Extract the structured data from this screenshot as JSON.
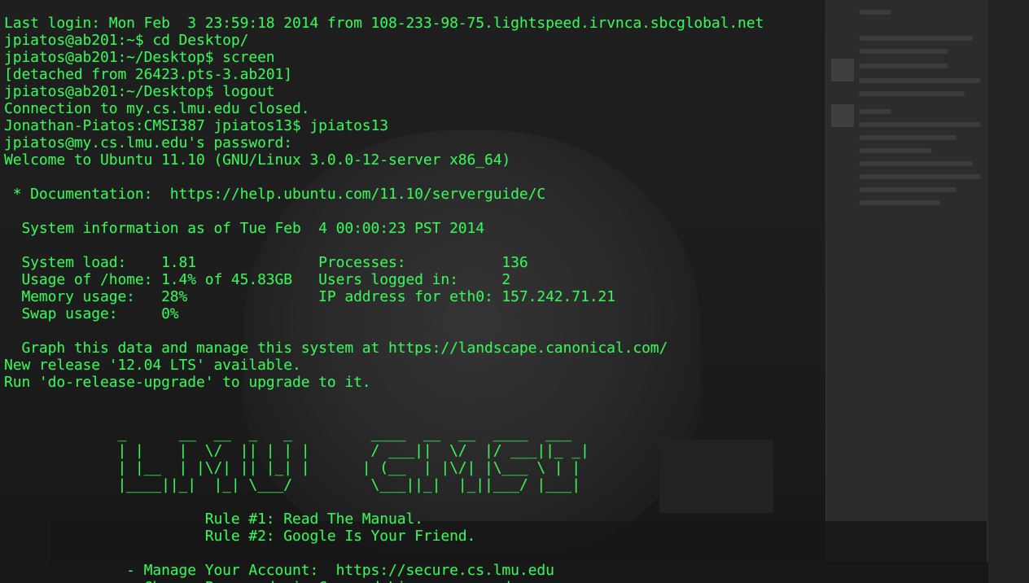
{
  "terminal": {
    "colors": {
      "text": "#3cf05a",
      "background_tint": "rgba(0,0,0,0.25)"
    },
    "lines": [
      "Last login: Mon Feb  3 23:59:18 2014 from 108-233-98-75.lightspeed.irvnca.sbcglobal.net",
      "jpiatos@ab201:~$ cd Desktop/",
      "jpiatos@ab201:~/Desktop$ screen",
      "[detached from 26423.pts-3.ab201]",
      "jpiatos@ab201:~/Desktop$ logout",
      "Connection to my.cs.lmu.edu closed.",
      "Jonathan-Piatos:CMSI387 jpiatos13$ jpiatos13",
      "jpiatos@my.cs.lmu.edu's password:",
      "Welcome to Ubuntu 11.10 (GNU/Linux 3.0.0-12-server x86_64)",
      "",
      " * Documentation:  https://help.ubuntu.com/11.10/serverguide/C",
      "",
      "  System information as of Tue Feb  4 00:00:23 PST 2014",
      "",
      "  System load:    1.81              Processes:           136",
      "  Usage of /home: 1.4% of 45.83GB   Users logged in:     2",
      "  Memory usage:   28%               IP address for eth0: 157.242.71.21",
      "  Swap usage:     0%",
      "",
      "  Graph this data and manage this system at https://landscape.canonical.com/",
      "New release '12.04 LTS' available.",
      "Run 'do-release-upgrade' to upgrade to it.",
      "",
      "",
      "             _      __  __  _   _         ____  __  __  ____  ___ ",
      "             | |    |  \\/  || | | |       / ___||  \\/  |/ ___||_ _|",
      "             | |__  | |\\/| || |_| |      | (__  | |\\/| |\\___ \\ | | ",
      "             |____||_|  |_| \\___/         \\___||_|  |_||___/ |___|",
      "",
      "                       Rule #1: Read The Manual.",
      "                       Rule #2: Google Is Your Friend.",
      "",
      "              - Manage Your Account:  https://secure.cs.lmu.edu",
      "              - Change Password via Command Line: yppasswd"
    ]
  }
}
